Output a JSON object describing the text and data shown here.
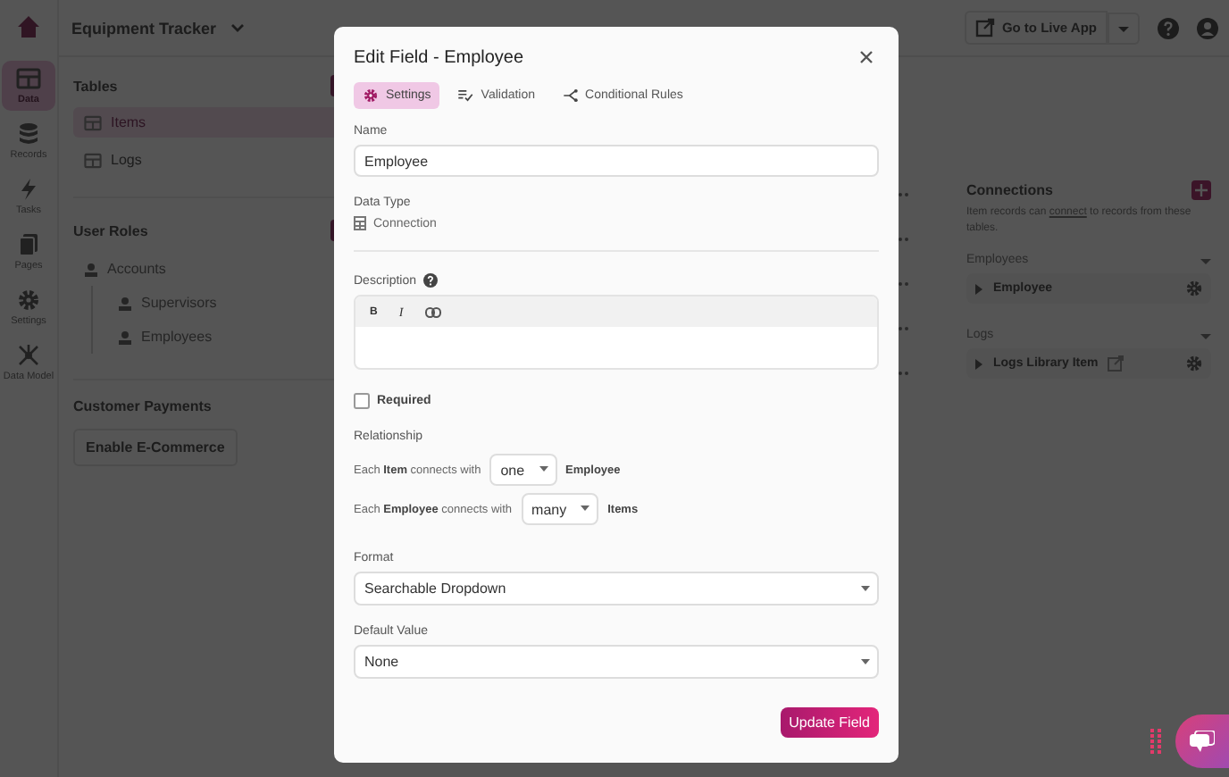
{
  "app": {
    "title": "Equipment Tracker",
    "live_button": "Go to Live App"
  },
  "nav": [
    {
      "label": "Data",
      "selected": true
    },
    {
      "label": "Records",
      "selected": false
    },
    {
      "label": "Tasks",
      "selected": false
    },
    {
      "label": "Pages",
      "selected": false
    },
    {
      "label": "Settings",
      "selected": false
    },
    {
      "label": "Data Model",
      "selected": false
    }
  ],
  "sidebar": {
    "tables_title": "Tables",
    "tables": [
      {
        "label": "Items",
        "selected": true
      },
      {
        "label": "Logs",
        "selected": false
      }
    ],
    "roles_title": "User Roles",
    "roles": [
      {
        "label": "Accounts",
        "children": [
          {
            "label": "Supervisors"
          },
          {
            "label": "Employees"
          }
        ]
      }
    ],
    "payments_title": "Customer Payments",
    "payments_button": "Enable E-Commerce"
  },
  "connections": {
    "title": "Connections",
    "text_before": "Item records can ",
    "link": "connect",
    "text_after": " to records from these tables.",
    "groups": [
      {
        "label": "Employees",
        "items": [
          {
            "label": "Employee",
            "external": false
          }
        ]
      },
      {
        "label": "Logs",
        "items": [
          {
            "label": "Logs Library Item",
            "external": true
          }
        ]
      }
    ]
  },
  "dialog": {
    "title": "Edit Field - Employee",
    "tabs": [
      {
        "label": "Settings",
        "selected": true
      },
      {
        "label": "Validation",
        "selected": false
      },
      {
        "label": "Conditional Rules",
        "selected": false
      }
    ],
    "name_label": "Name",
    "name_value": "Employee",
    "type_label": "Data Type",
    "type_value": "Connection",
    "description_label": "Description",
    "toolbar": [
      "B",
      "I"
    ],
    "required": {
      "label": "Required",
      "checked": false
    },
    "relationship_label": "Relationship",
    "relations": [
      {
        "text": "Each **Item** connects with",
        "value": "one",
        "target": "Employee"
      },
      {
        "text": "Each **Employee** connects with",
        "value": "many",
        "target": "Items"
      }
    ],
    "format_label": "Format",
    "format_value": "Searchable Dropdown",
    "default_label": "Default Value",
    "default_value": "None",
    "submit": "Update Field"
  }
}
